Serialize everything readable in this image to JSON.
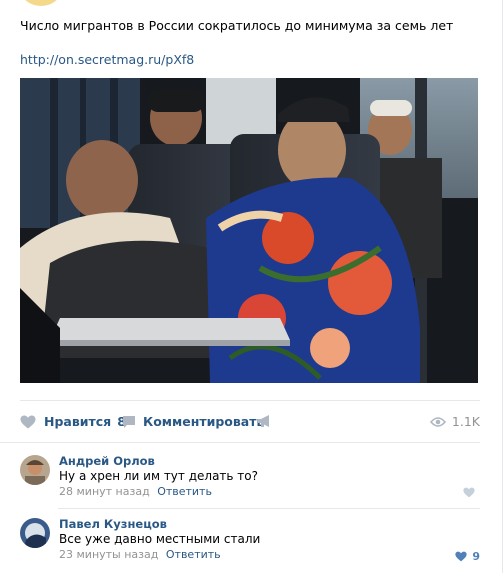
{
  "post": {
    "text": "Число мигрантов в России сократилось до минимума за семь лет",
    "link": "http://on.secretmag.ru/pXf8"
  },
  "actions": {
    "like_label": "Нравится",
    "like_count": "8",
    "comment_label": "Комментировать",
    "views": "1.1K"
  },
  "comments": [
    {
      "author": "Андрей Орлов",
      "text": "Ну а хрен ли им тут делать то?",
      "time": "28 минут назад",
      "reply_label": "Ответить",
      "likes": ""
    },
    {
      "author": "Павел Кузнецов",
      "text": "Все уже давно местными стали",
      "time": "23 минуты назад",
      "reply_label": "Ответить",
      "likes": "9"
    }
  ],
  "colors": {
    "link": "#2a5885",
    "muted": "#939393",
    "accent": "#5181b8",
    "divider": "#e7e8ec"
  }
}
